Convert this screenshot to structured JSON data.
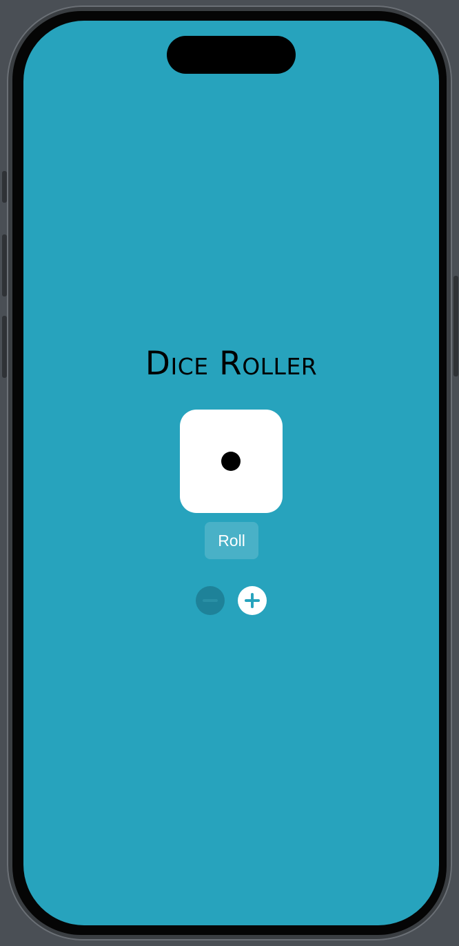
{
  "app": {
    "title": "Dice Roller",
    "background_color": "#27a3bd"
  },
  "die": {
    "face_value": 1,
    "face_color": "#ffffff",
    "pip_color": "#000000"
  },
  "controls": {
    "roll_label": "Roll",
    "decrement_icon": "minus-circle-icon",
    "increment_icon": "plus-circle-icon",
    "decrement_enabled": false,
    "increment_enabled": true
  }
}
